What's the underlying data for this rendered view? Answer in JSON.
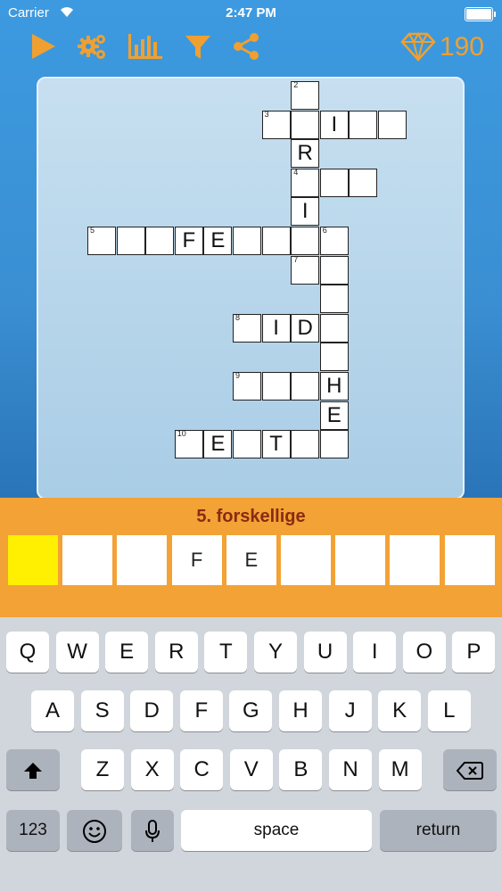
{
  "status_bar": {
    "carrier": "Carrier",
    "time": "2:47 PM"
  },
  "toolbar": {
    "icons": [
      "play-icon",
      "settings-gears-icon",
      "stats-bar-chart-icon",
      "filter-icon",
      "share-icon"
    ],
    "gem_icon": "diamond-icon",
    "gem_count": "190",
    "accent_color": "#f0a030"
  },
  "board": {
    "cells": [
      {
        "c": 7,
        "r": 0,
        "n": "2",
        "t": ""
      },
      {
        "c": 6,
        "r": 1,
        "n": "3",
        "t": ""
      },
      {
        "c": 7,
        "r": 1,
        "n": "",
        "t": ""
      },
      {
        "c": 8,
        "r": 1,
        "n": "",
        "t": "I"
      },
      {
        "c": 9,
        "r": 1,
        "n": "",
        "t": ""
      },
      {
        "c": 10,
        "r": 1,
        "n": "",
        "t": ""
      },
      {
        "c": 7,
        "r": 2,
        "n": "",
        "t": "R"
      },
      {
        "c": 7,
        "r": 3,
        "n": "4",
        "t": ""
      },
      {
        "c": 8,
        "r": 3,
        "n": "",
        "t": ""
      },
      {
        "c": 9,
        "r": 3,
        "n": "",
        "t": ""
      },
      {
        "c": 7,
        "r": 4,
        "n": "",
        "t": "I"
      },
      {
        "c": 0,
        "r": 5,
        "n": "5",
        "t": ""
      },
      {
        "c": 1,
        "r": 5,
        "n": "",
        "t": ""
      },
      {
        "c": 2,
        "r": 5,
        "n": "",
        "t": ""
      },
      {
        "c": 3,
        "r": 5,
        "n": "",
        "t": "F"
      },
      {
        "c": 4,
        "r": 5,
        "n": "",
        "t": "E"
      },
      {
        "c": 5,
        "r": 5,
        "n": "",
        "t": ""
      },
      {
        "c": 6,
        "r": 5,
        "n": "",
        "t": ""
      },
      {
        "c": 7,
        "r": 5,
        "n": "",
        "t": ""
      },
      {
        "c": 8,
        "r": 5,
        "n": "6",
        "t": ""
      },
      {
        "c": 7,
        "r": 6,
        "n": "7",
        "t": ""
      },
      {
        "c": 8,
        "r": 6,
        "n": "",
        "t": ""
      },
      {
        "c": 8,
        "r": 7,
        "n": "",
        "t": ""
      },
      {
        "c": 5,
        "r": 8,
        "n": "8",
        "t": ""
      },
      {
        "c": 6,
        "r": 8,
        "n": "",
        "t": "I"
      },
      {
        "c": 7,
        "r": 8,
        "n": "",
        "t": "D"
      },
      {
        "c": 8,
        "r": 8,
        "n": "",
        "t": ""
      },
      {
        "c": 8,
        "r": 9,
        "n": "",
        "t": ""
      },
      {
        "c": 5,
        "r": 10,
        "n": "9",
        "t": ""
      },
      {
        "c": 6,
        "r": 10,
        "n": "",
        "t": ""
      },
      {
        "c": 7,
        "r": 10,
        "n": "",
        "t": ""
      },
      {
        "c": 8,
        "r": 10,
        "n": "",
        "t": "H"
      },
      {
        "c": 8,
        "r": 11,
        "n": "",
        "t": "E"
      },
      {
        "c": 3,
        "r": 12,
        "n": "10",
        "t": ""
      },
      {
        "c": 4,
        "r": 12,
        "n": "",
        "t": "E"
      },
      {
        "c": 5,
        "r": 12,
        "n": "",
        "t": ""
      },
      {
        "c": 6,
        "r": 12,
        "n": "",
        "t": "T"
      },
      {
        "c": 7,
        "r": 12,
        "n": "",
        "t": ""
      },
      {
        "c": 8,
        "r": 12,
        "n": "",
        "t": ""
      }
    ]
  },
  "clue": {
    "title": "5. forskellige",
    "answer": [
      "",
      "",
      "",
      "F",
      "E",
      "",
      "",
      "",
      ""
    ],
    "active_index": 0,
    "highlight_color": "#ffef00"
  },
  "keyboard": {
    "rows": [
      [
        "Q",
        "W",
        "E",
        "R",
        "T",
        "Y",
        "U",
        "I",
        "O",
        "P"
      ],
      [
        "A",
        "S",
        "D",
        "F",
        "G",
        "H",
        "J",
        "K",
        "L"
      ],
      [
        "Z",
        "X",
        "C",
        "V",
        "B",
        "N",
        "M"
      ]
    ],
    "shift_icon": "shift-arrow-icon",
    "delete_icon": "backspace-icon",
    "numbers_label": "123",
    "emoji_icon": "emoji-icon",
    "mic_icon": "microphone-icon",
    "space_label": "space",
    "return_label": "return"
  }
}
